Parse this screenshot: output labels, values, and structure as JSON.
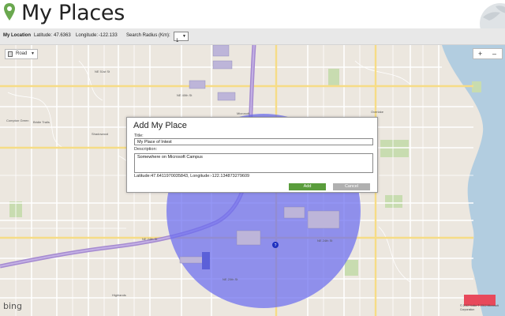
{
  "header": {
    "title": "My Places"
  },
  "location_bar": {
    "my_location_label": "My Location",
    "latitude_label": "Latitude:",
    "latitude_value": "47.6363",
    "longitude_label": "Longitude:",
    "longitude_value": "-122.133",
    "radius_label": "Search Radius (Km):",
    "radius_value": "1"
  },
  "map": {
    "map_type": "Road",
    "zoom_in": "+",
    "zoom_out": "–",
    "brand": "bing",
    "copyright": "© 2012 Nokia  © 2012 Microsoft Corporation",
    "search_circle_color": "#6b6ef0",
    "labels": {
      "ne_24th_st": "NE 24th St",
      "ne_20th_st": "NE 20th St",
      "highlands": "Highlands",
      "bridle_trails": "Bridle Trails",
      "compton_green": "Compton Green",
      "shadowood": "Shadowood",
      "overlake": "Overlake",
      "ne_40th_st": "NE 40th St",
      "ne_51st_st": "NE 51st St",
      "microsoft": "Microsoft"
    }
  },
  "dialog": {
    "title": "Add My Place",
    "title_label": "Title:",
    "title_value": "My Place of Intest",
    "description_label": "Description:",
    "description_value": "Somewhere on Microsoft Campus",
    "coords_text": "Latitude:47.6411970035843, Longitude:-122.134873279609",
    "add_label": "Add",
    "cancel_label": "Cancel"
  }
}
